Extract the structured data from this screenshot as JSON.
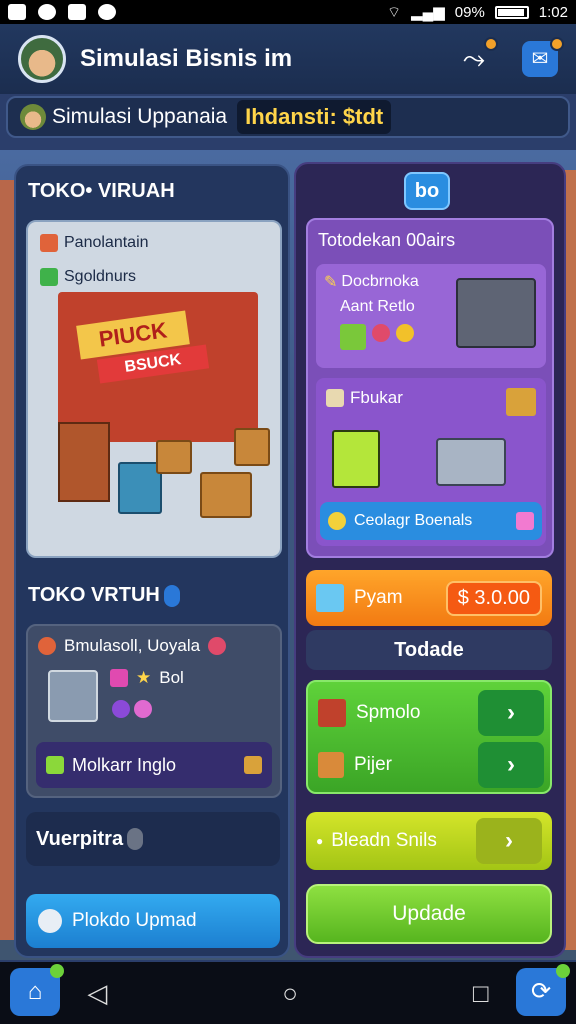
{
  "status_bar": {
    "battery": "09%",
    "time": "1:02"
  },
  "header": {
    "title": "Simulasi Bisnis im"
  },
  "subbar": {
    "title": "Simulasi Uppanaia",
    "money": "Ihdansti: $tdt"
  },
  "left": {
    "heading": "TOKO• VIRUAH",
    "scene": {
      "tag1": "Panolantain",
      "tag2": "Sgoldnurs",
      "sign_main": "PIUCK",
      "sign_sub": "BSUCK"
    },
    "section_heading": "TOKO VRTUH",
    "section_card": {
      "row1": "Bmulasoll, Uoyala",
      "row2": "Bol",
      "button": "Molkarr Inglo"
    },
    "mini_bar": "Vuerpitra",
    "blue_button": "Plokdo Upmad"
  },
  "right": {
    "badge": "bo",
    "card_title": "Totodekan 00airs",
    "inner1_line1": "Docbrnoka",
    "inner1_line2": "Aant Retlo",
    "inner2_label": "Fbukar",
    "inner3_label": "Ceolagr Boenals",
    "orange_label": "Pyam",
    "price": "$ 3.0.00",
    "dark_strip": "Todade",
    "green_row1": "Spmolo",
    "green_row2": "Pijer",
    "yellow_label": "Bleadn Snils",
    "update_button": "Updade"
  },
  "colors": {
    "accent_blue": "#2a78d8",
    "green": "#5fd23a",
    "orange": "#f27a12",
    "purple": "#7b4fb8",
    "money_yellow": "#ffd54a"
  },
  "icons": [
    "share-icon",
    "message-icon",
    "home-icon",
    "back-icon",
    "circle-home-icon",
    "recents-icon",
    "refresh-icon"
  ]
}
